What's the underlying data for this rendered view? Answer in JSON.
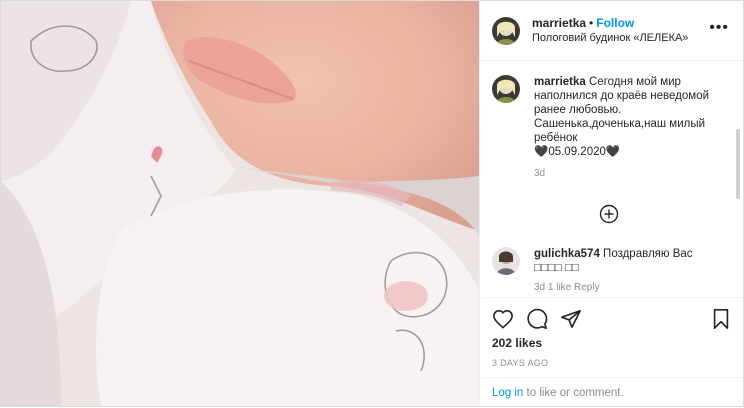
{
  "post": {
    "username": "marrietka",
    "follow_label": "Follow",
    "location": "Пологовий будинок «ЛЕЛЕКА»",
    "caption_text": "Сегодня мой мир наполнился до краёв неведомой ранее любовью.",
    "caption_line2": "Сашенька,доченька,наш милый ребёнок",
    "caption_line3": "🖤05.09.2020🖤",
    "caption_time": "3d",
    "likes": "202 likes",
    "posted_ago": "3 DAYS AGO"
  },
  "comment": {
    "username": "gulichka574",
    "text": "Поздравляю Вас □□□□ □□",
    "meta": "3d   1 like   Reply"
  },
  "footer": {
    "login_link": "Log in",
    "login_rest": " to like or comment."
  },
  "icons": {
    "more": "more-options-icon",
    "like": "heart-icon",
    "comment": "comment-icon",
    "share": "share-icon",
    "save": "bookmark-icon",
    "load_more": "plus-circle-icon"
  },
  "colors": {
    "accent": "#0095f6",
    "text": "#262626",
    "muted": "#8e8e8e"
  }
}
